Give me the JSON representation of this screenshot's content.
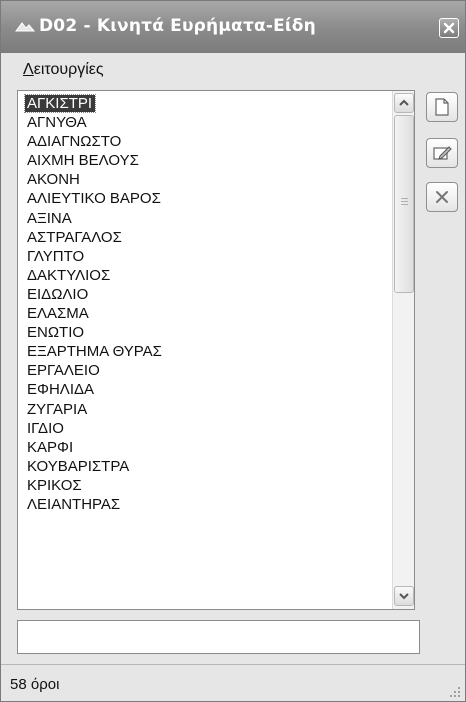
{
  "window": {
    "title": "D02 - Κινητά Ευρήματα-Είδη"
  },
  "menu": {
    "items": [
      {
        "label_hotkey": "Λ",
        "label_rest": "ειτουργίες"
      }
    ]
  },
  "list": {
    "selected_index": 0,
    "items": [
      "ΑΓΚΙΣΤΡΙ",
      "ΑΓΝΥΘΑ",
      "ΑΔΙΑΓΝΩΣΤΟ",
      "ΑΙΧΜΗ ΒΕΛΟΥΣ",
      "ΑΚΟΝΗ",
      "ΑΛΙΕΥΤΙΚΟ ΒΑΡΟΣ",
      "ΑΞΙΝΑ",
      "ΑΣΤΡΑΓΑΛΟΣ",
      "ΓΛΥΠΤΟ",
      "ΔΑΚΤΥΛΙΟΣ",
      "ΕΙΔΩΛΙΟ",
      "ΕΛΑΣΜΑ",
      "ΕΝΩΤΙΟ",
      "ΕΞΑΡΤΗΜΑ ΘΥΡΑΣ",
      "ΕΡΓΑΛΕΙΟ",
      "ΕΦΗΛΙΔΑ",
      "ΖΥΓΑΡΙΑ",
      "ΙΓΔΙΟ",
      "ΚΑΡΦΙ",
      "ΚΟΥΒΑΡΙΣΤΡΑ",
      "ΚΡΙΚΟΣ",
      "ΛΕΙΑΝΤΗΡΑΣ"
    ]
  },
  "toolbar": {
    "buttons": [
      {
        "icon": "new-document-icon"
      },
      {
        "icon": "edit-icon"
      },
      {
        "icon": "delete-icon"
      }
    ]
  },
  "input": {
    "value": ""
  },
  "status": {
    "text": "58 όροι"
  },
  "colors": {
    "titlebar": "#8a8a8a",
    "selection": "#3a3a3a"
  }
}
